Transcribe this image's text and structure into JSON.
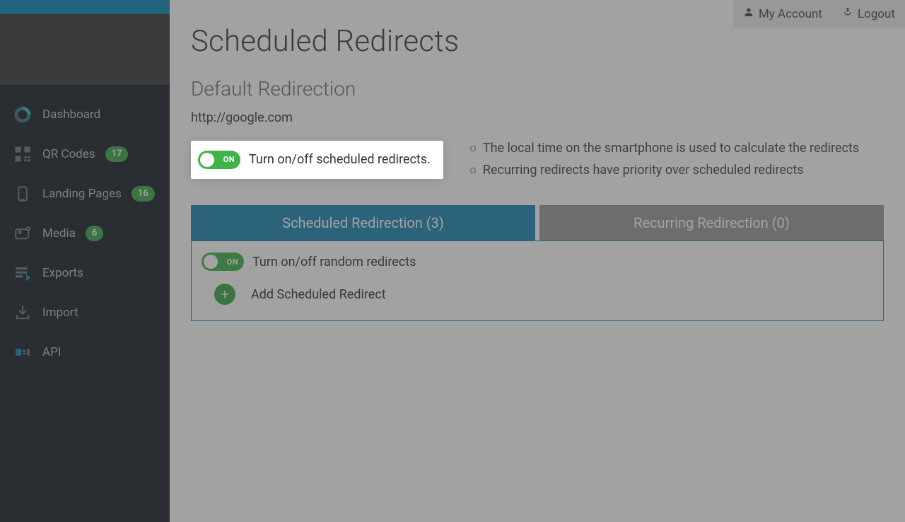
{
  "header": {
    "my_account": "My Account",
    "logout": "Logout"
  },
  "sidebar": {
    "items": [
      {
        "label": "Dashboard"
      },
      {
        "label": "QR Codes",
        "badge": "17"
      },
      {
        "label": "Landing Pages",
        "badge": "16"
      },
      {
        "label": "Media",
        "badge": "6"
      },
      {
        "label": "Exports"
      },
      {
        "label": "Import"
      },
      {
        "label": "API"
      }
    ]
  },
  "page": {
    "title": "Scheduled Redirects",
    "subheading": "Default Redirection",
    "default_url": "http://google.com",
    "toggle_on_text": "ON",
    "toggle_scheduled_label": "Turn on/off scheduled redirects.",
    "info_lines": [
      "The local time on the smartphone is used to calculate the redirects",
      "Recurring redirects have priority over scheduled redirects"
    ],
    "tabs": {
      "scheduled": "Scheduled Redirection (3)",
      "recurring": "Recurring Redirection (0)"
    },
    "random_toggle_label": "Turn on/off random redirects",
    "add_scheduled_label": "Add Scheduled Redirect"
  }
}
